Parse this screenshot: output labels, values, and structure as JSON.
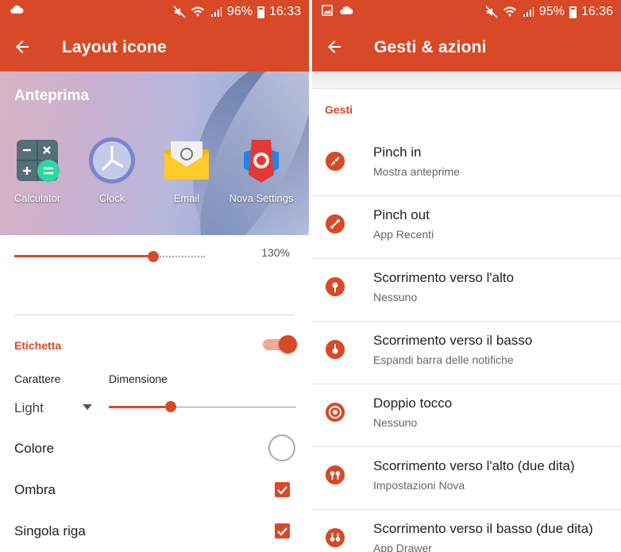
{
  "left": {
    "status": {
      "battery": "96%",
      "time": "16:33"
    },
    "appbar": {
      "title": "Layout icone"
    },
    "preview": {
      "title": "Anteprima",
      "apps": [
        {
          "label": "Calculator",
          "icon": "calculator-icon"
        },
        {
          "label": "Clock",
          "icon": "clock-icon"
        },
        {
          "label": "Email",
          "icon": "email-icon"
        },
        {
          "label": "Nova Settings",
          "icon": "nova-settings-icon"
        }
      ]
    },
    "icon_size": {
      "value_label": "130%",
      "fill_fraction": 0.73
    },
    "label_section": {
      "title": "Etichetta",
      "enabled": true,
      "font_label": "Carattere",
      "font_value": "Light",
      "size_label": "Dimensione",
      "size_fraction": 0.33,
      "color_label": "Colore",
      "shadow_label": "Ombra",
      "shadow_checked": true,
      "single_line_label": "Singola riga",
      "single_line_checked": true
    }
  },
  "right": {
    "status": {
      "battery": "95%",
      "time": "16:36"
    },
    "appbar": {
      "title": "Gesti & azioni"
    },
    "section": "Gesti",
    "items": [
      {
        "title": "Pinch in",
        "subtitle": "Mostra anteprime",
        "icon": "pinch-in-icon"
      },
      {
        "title": "Pinch out",
        "subtitle": "App Recenti",
        "icon": "pinch-out-icon"
      },
      {
        "title": "Scorrimento verso l'alto",
        "subtitle": "Nessuno",
        "icon": "swipe-up-icon"
      },
      {
        "title": "Scorrimento verso il basso",
        "subtitle": "Espandi barra delle notifiche",
        "icon": "swipe-down-icon"
      },
      {
        "title": "Doppio tocco",
        "subtitle": "Nessuno",
        "icon": "double-tap-icon"
      },
      {
        "title": "Scorrimento verso l'alto (due dita)",
        "subtitle": "Impostazioni Nova",
        "icon": "two-finger-swipe-up-icon"
      },
      {
        "title": "Scorrimento verso il basso (due dita)",
        "subtitle": "App Drawer",
        "icon": "two-finger-swipe-down-icon"
      }
    ]
  },
  "colors": {
    "accent": "#d84927",
    "accent_light": "#f0a898",
    "divider": "#e2e2e2"
  }
}
